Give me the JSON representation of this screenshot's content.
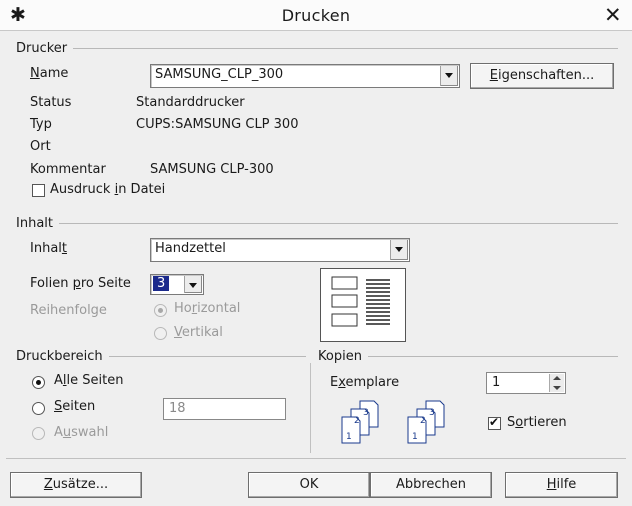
{
  "window": {
    "title": "Drucken"
  },
  "printer": {
    "group": "Drucker",
    "name_label": "Name",
    "name_value": "SAMSUNG_CLP_300",
    "properties_button": "Eigenschaften...",
    "status_label": "Status",
    "status_value": "Standarddrucker",
    "type_label": "Typ",
    "type_value": "CUPS:SAMSUNG  CLP  300",
    "location_label": "Ort",
    "comment_label": "Kommentar",
    "comment_value": "SAMSUNG CLP-300",
    "print_to_file": "Ausdruck in Datei",
    "print_to_file_checked": false
  },
  "content": {
    "group": "Inhalt",
    "content_label": "Inhalt",
    "content_value": "Handzettel",
    "slides_per_page_label": "Folien pro Seite",
    "slides_per_page_value": "3",
    "order_label": "Reihenfolge",
    "order_options": [
      "Horizontal",
      "Vertikal"
    ]
  },
  "range": {
    "group": "Druckbereich",
    "options": [
      "Alle Seiten",
      "Seiten",
      "Auswahl"
    ],
    "selected": "Alle Seiten",
    "pages_value": "18"
  },
  "copies": {
    "group": "Kopien",
    "copies_label": "Exemplare",
    "copies_value": "1",
    "collate_label": "Sortieren",
    "collate_checked": true,
    "pages": [
      "1",
      "2",
      "3"
    ]
  },
  "buttons": {
    "options": "Zusätze...",
    "ok": "OK",
    "cancel": "Abbrechen",
    "help": "Hilfe"
  }
}
